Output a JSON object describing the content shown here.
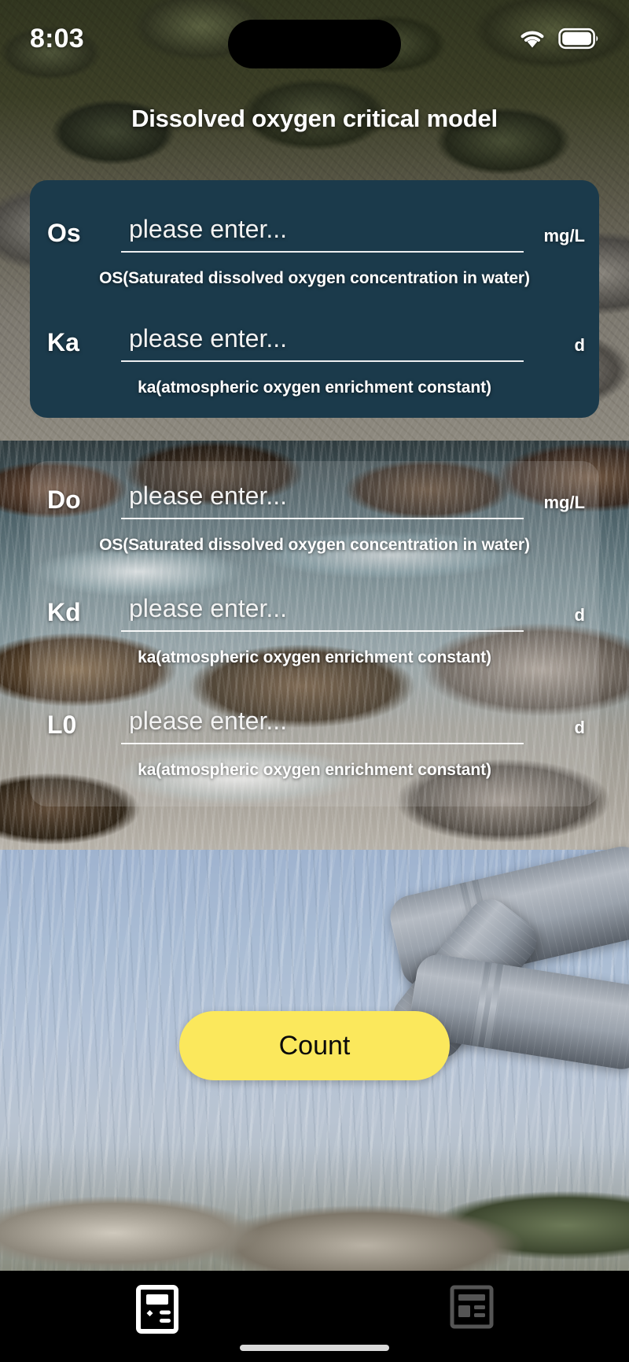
{
  "status_bar": {
    "time": "8:03",
    "wifi_icon": "wifi-icon",
    "battery_icon": "battery-full-icon",
    "dynamic_island": "dynamic-island"
  },
  "header": {
    "title": "Dissolved oxygen critical model"
  },
  "form": {
    "placeholder": "please enter...",
    "card_color": "#1b3a4b",
    "groups": [
      {
        "style": "solid",
        "fields": [
          {
            "label": "Os",
            "value": "",
            "placeholder": "please enter...",
            "unit": "mg/L",
            "hint": "OS(Saturated dissolved oxygen concentration in water)"
          },
          {
            "label": "Ka",
            "value": "",
            "placeholder": "please enter...",
            "unit": "d",
            "hint": "ka(atmospheric oxygen enrichment constant)"
          }
        ]
      },
      {
        "style": "translucent",
        "fields": [
          {
            "label": "Do",
            "value": "",
            "placeholder": "please enter...",
            "unit": "mg/L",
            "hint": "OS(Saturated dissolved oxygen concentration in water)"
          },
          {
            "label": "Kd",
            "value": "",
            "placeholder": "please enter...",
            "unit": "d",
            "hint": "ka(atmospheric oxygen enrichment constant)"
          },
          {
            "label": "L0",
            "value": "",
            "placeholder": "please enter...",
            "unit": "d",
            "hint": "ka(atmospheric oxygen enrichment constant)"
          }
        ]
      }
    ]
  },
  "actions": {
    "count_label": "Count",
    "count_color": "#fbe85c"
  },
  "tab_bar": {
    "items": [
      {
        "name": "calculator-icon",
        "active": true
      },
      {
        "name": "article-icon",
        "active": false
      }
    ],
    "active_color": "#ffffff",
    "inactive_color": "#555555"
  }
}
